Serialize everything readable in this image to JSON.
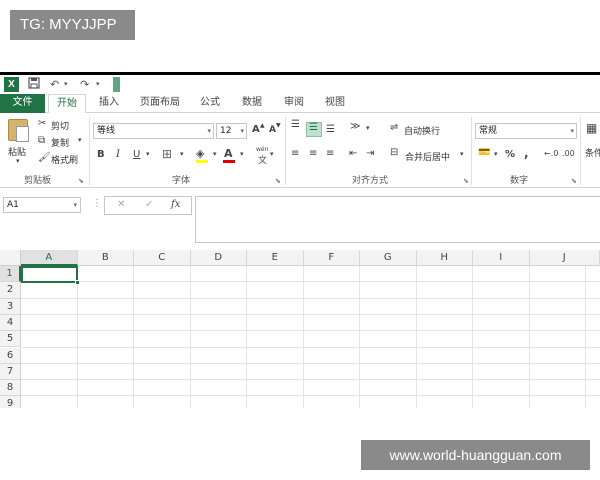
{
  "watermarks": {
    "top": "TG: MYYJJPP",
    "bottom": "www.world-huangguan.com"
  },
  "app": {
    "logo": "X",
    "accent_color": "#217346"
  },
  "qat": {
    "icons": [
      "excel-logo-icon",
      "save-icon",
      "undo-icon",
      "redo-icon"
    ]
  },
  "tabs": [
    {
      "label": "文件"
    },
    {
      "label": "开始"
    },
    {
      "label": "插入"
    },
    {
      "label": "页面布局"
    },
    {
      "label": "公式"
    },
    {
      "label": "数据"
    },
    {
      "label": "审阅"
    },
    {
      "label": "视图"
    }
  ],
  "ribbon": {
    "clipboard": {
      "paste_label": "粘贴",
      "cut_label": "剪切",
      "copy_label": "复制",
      "format_painter_label": "格式刷",
      "group_label": "剪贴板"
    },
    "font": {
      "font_name": "等线",
      "font_size": "12",
      "increase_size": "A",
      "decrease_size": "A",
      "bold": "B",
      "italic": "I",
      "underline": "U",
      "font_color": "A",
      "phonetic": "wén",
      "group_label": "字体"
    },
    "alignment": {
      "wrap_text_label": "自动换行",
      "merge_center_label": "合并后居中",
      "group_label": "对齐方式"
    },
    "number": {
      "format": "常规",
      "percent": "%",
      "comma": ",",
      "group_label": "数字"
    },
    "styles": {
      "conditional_label": "条件"
    }
  },
  "formula_bar": {
    "name_box": "A1",
    "fx": "fx",
    "cancel": "✕",
    "enter": "✓",
    "value": ""
  },
  "sheet": {
    "columns": [
      "A",
      "B",
      "C",
      "D",
      "E",
      "F",
      "G",
      "H",
      "I",
      "J"
    ],
    "rows": [
      "1",
      "2",
      "3",
      "4",
      "5",
      "6",
      "7",
      "8",
      "9"
    ],
    "active_cell": "A1"
  }
}
